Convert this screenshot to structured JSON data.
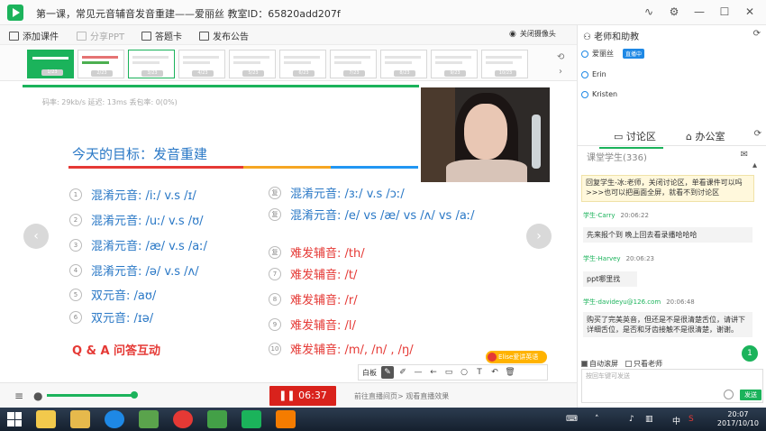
{
  "titlebar": {
    "title": "第一课，常见元音辅音发音重建——爱丽丝    教室ID：65820add207f",
    "icons": [
      "pulse-icon",
      "gear-icon",
      "minimize-icon",
      "maximize-icon",
      "close-icon"
    ]
  },
  "toolbar": {
    "add_courseware": "添加课件",
    "share_ppt": "分享PPT",
    "answer_card": "答题卡",
    "announcement": "发布公告",
    "close_camera": "关闭摄像头"
  },
  "thumbnails": [
    "1/23",
    "2/23",
    "3/23",
    "4/23",
    "5/23",
    "6/23",
    "7/23",
    "8/23",
    "9/23",
    "10/23"
  ],
  "slide": {
    "stats": "码率: 29kb/s    延迟: 13ms    丢包率: 0(0%)",
    "goal": "今天的目标：发音重建",
    "left_rows": [
      {
        "n": "1",
        "text": "混淆元音:  /iː/  v.s  /ɪ/"
      },
      {
        "n": "2",
        "text": "混淆元音:  /uː/  v.s  /ʊ/"
      },
      {
        "n": "3",
        "text": "混淆元音:  /æ/    v.s    /aː/"
      },
      {
        "n": "4",
        "text": "混淆元音:  /ə/  v.s  /ʌ/"
      },
      {
        "n": "5",
        "text": "双元音:  /aʊ/"
      },
      {
        "n": "6",
        "text": "双元音:  /ɪə/"
      }
    ],
    "right_rows": [
      {
        "n": "复",
        "text": "混淆元音:  /ɜː/  v.s  /ɔː/"
      },
      {
        "n": "复",
        "text": "混淆元音:  /e/  vs  /æ/ vs  /ʌ/  vs  /aː/"
      },
      {
        "n": "复",
        "text": "难发辅音: /th/"
      },
      {
        "n": "7",
        "text": "难发辅音: /t/"
      },
      {
        "n": "8",
        "text": "难发辅音: /r/"
      },
      {
        "n": "9",
        "text": "难发辅音: /l/"
      },
      {
        "n": "10",
        "text": "难发辅音: /m/,  /n/ , /ŋ/"
      }
    ],
    "qa": "Q & A 问答互动"
  },
  "drawbar": {
    "whiteboard": "白板",
    "tools": [
      "brush-icon",
      "pen-icon",
      "line-icon",
      "arrow-icon",
      "rect-icon",
      "circle-icon",
      "text-icon",
      "undo-icon",
      "delete-icon"
    ]
  },
  "elise_badge": "Elise爱讲英语",
  "bottombar": {
    "timer": "06:37",
    "link_text": "前往直播间页> 观看直播效果"
  },
  "right_panel": {
    "teacher_header": "老师和助教",
    "members": [
      {
        "name": "爱丽丝",
        "badge": "直播中"
      },
      {
        "name": "Erin",
        "badge": ""
      },
      {
        "name": "Kristen",
        "badge": ""
      }
    ],
    "tab_discuss": "讨论区",
    "tab_office": "办公室",
    "room_label": "课堂学生(336)",
    "notice": "回复学生-冰:老师，关闭讨论区，单看课件可以吗 >>>也可以把画面全屏，就看不到讨论区",
    "messages": [
      {
        "name": "学生-Carry",
        "time": "20:06:22",
        "body": "先来报个到 晚上回去看录播哈哈哈"
      },
      {
        "name": "学生-Harvey",
        "time": "20:06:23",
        "body": "ppt哪里找"
      },
      {
        "name": "学生-davideyu@126.com",
        "time": "20:06:48",
        "body": "购买了完美英音，但还是不是很清楚舌位，请讲下详细舌位，是否和牙齿接触不是很清楚，谢谢。"
      }
    ],
    "auto_scroll": "自动滚屏",
    "teacher_only": "只看老师",
    "input_placeholder": "按回车键可发送",
    "send": "发送",
    "scroll_count": "1"
  },
  "taskbar": {
    "time": "20:07",
    "date": "2017/10/10",
    "lang": "中"
  }
}
